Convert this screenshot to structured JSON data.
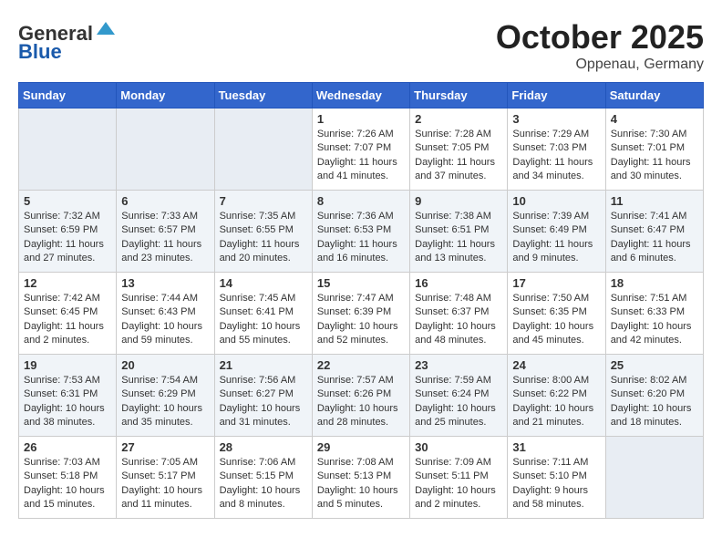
{
  "header": {
    "logo_line1": "General",
    "logo_line2": "Blue",
    "month": "October 2025",
    "location": "Oppenau, Germany"
  },
  "weekdays": [
    "Sunday",
    "Monday",
    "Tuesday",
    "Wednesday",
    "Thursday",
    "Friday",
    "Saturday"
  ],
  "weeks": [
    [
      {
        "day": "",
        "info": ""
      },
      {
        "day": "",
        "info": ""
      },
      {
        "day": "",
        "info": ""
      },
      {
        "day": "1",
        "info": "Sunrise: 7:26 AM\nSunset: 7:07 PM\nDaylight: 11 hours\nand 41 minutes."
      },
      {
        "day": "2",
        "info": "Sunrise: 7:28 AM\nSunset: 7:05 PM\nDaylight: 11 hours\nand 37 minutes."
      },
      {
        "day": "3",
        "info": "Sunrise: 7:29 AM\nSunset: 7:03 PM\nDaylight: 11 hours\nand 34 minutes."
      },
      {
        "day": "4",
        "info": "Sunrise: 7:30 AM\nSunset: 7:01 PM\nDaylight: 11 hours\nand 30 minutes."
      }
    ],
    [
      {
        "day": "5",
        "info": "Sunrise: 7:32 AM\nSunset: 6:59 PM\nDaylight: 11 hours\nand 27 minutes."
      },
      {
        "day": "6",
        "info": "Sunrise: 7:33 AM\nSunset: 6:57 PM\nDaylight: 11 hours\nand 23 minutes."
      },
      {
        "day": "7",
        "info": "Sunrise: 7:35 AM\nSunset: 6:55 PM\nDaylight: 11 hours\nand 20 minutes."
      },
      {
        "day": "8",
        "info": "Sunrise: 7:36 AM\nSunset: 6:53 PM\nDaylight: 11 hours\nand 16 minutes."
      },
      {
        "day": "9",
        "info": "Sunrise: 7:38 AM\nSunset: 6:51 PM\nDaylight: 11 hours\nand 13 minutes."
      },
      {
        "day": "10",
        "info": "Sunrise: 7:39 AM\nSunset: 6:49 PM\nDaylight: 11 hours\nand 9 minutes."
      },
      {
        "day": "11",
        "info": "Sunrise: 7:41 AM\nSunset: 6:47 PM\nDaylight: 11 hours\nand 6 minutes."
      }
    ],
    [
      {
        "day": "12",
        "info": "Sunrise: 7:42 AM\nSunset: 6:45 PM\nDaylight: 11 hours\nand 2 minutes."
      },
      {
        "day": "13",
        "info": "Sunrise: 7:44 AM\nSunset: 6:43 PM\nDaylight: 10 hours\nand 59 minutes."
      },
      {
        "day": "14",
        "info": "Sunrise: 7:45 AM\nSunset: 6:41 PM\nDaylight: 10 hours\nand 55 minutes."
      },
      {
        "day": "15",
        "info": "Sunrise: 7:47 AM\nSunset: 6:39 PM\nDaylight: 10 hours\nand 52 minutes."
      },
      {
        "day": "16",
        "info": "Sunrise: 7:48 AM\nSunset: 6:37 PM\nDaylight: 10 hours\nand 48 minutes."
      },
      {
        "day": "17",
        "info": "Sunrise: 7:50 AM\nSunset: 6:35 PM\nDaylight: 10 hours\nand 45 minutes."
      },
      {
        "day": "18",
        "info": "Sunrise: 7:51 AM\nSunset: 6:33 PM\nDaylight: 10 hours\nand 42 minutes."
      }
    ],
    [
      {
        "day": "19",
        "info": "Sunrise: 7:53 AM\nSunset: 6:31 PM\nDaylight: 10 hours\nand 38 minutes."
      },
      {
        "day": "20",
        "info": "Sunrise: 7:54 AM\nSunset: 6:29 PM\nDaylight: 10 hours\nand 35 minutes."
      },
      {
        "day": "21",
        "info": "Sunrise: 7:56 AM\nSunset: 6:27 PM\nDaylight: 10 hours\nand 31 minutes."
      },
      {
        "day": "22",
        "info": "Sunrise: 7:57 AM\nSunset: 6:26 PM\nDaylight: 10 hours\nand 28 minutes."
      },
      {
        "day": "23",
        "info": "Sunrise: 7:59 AM\nSunset: 6:24 PM\nDaylight: 10 hours\nand 25 minutes."
      },
      {
        "day": "24",
        "info": "Sunrise: 8:00 AM\nSunset: 6:22 PM\nDaylight: 10 hours\nand 21 minutes."
      },
      {
        "day": "25",
        "info": "Sunrise: 8:02 AM\nSunset: 6:20 PM\nDaylight: 10 hours\nand 18 minutes."
      }
    ],
    [
      {
        "day": "26",
        "info": "Sunrise: 7:03 AM\nSunset: 5:18 PM\nDaylight: 10 hours\nand 15 minutes."
      },
      {
        "day": "27",
        "info": "Sunrise: 7:05 AM\nSunset: 5:17 PM\nDaylight: 10 hours\nand 11 minutes."
      },
      {
        "day": "28",
        "info": "Sunrise: 7:06 AM\nSunset: 5:15 PM\nDaylight: 10 hours\nand 8 minutes."
      },
      {
        "day": "29",
        "info": "Sunrise: 7:08 AM\nSunset: 5:13 PM\nDaylight: 10 hours\nand 5 minutes."
      },
      {
        "day": "30",
        "info": "Sunrise: 7:09 AM\nSunset: 5:11 PM\nDaylight: 10 hours\nand 2 minutes."
      },
      {
        "day": "31",
        "info": "Sunrise: 7:11 AM\nSunset: 5:10 PM\nDaylight: 9 hours\nand 58 minutes."
      },
      {
        "day": "",
        "info": ""
      }
    ]
  ]
}
